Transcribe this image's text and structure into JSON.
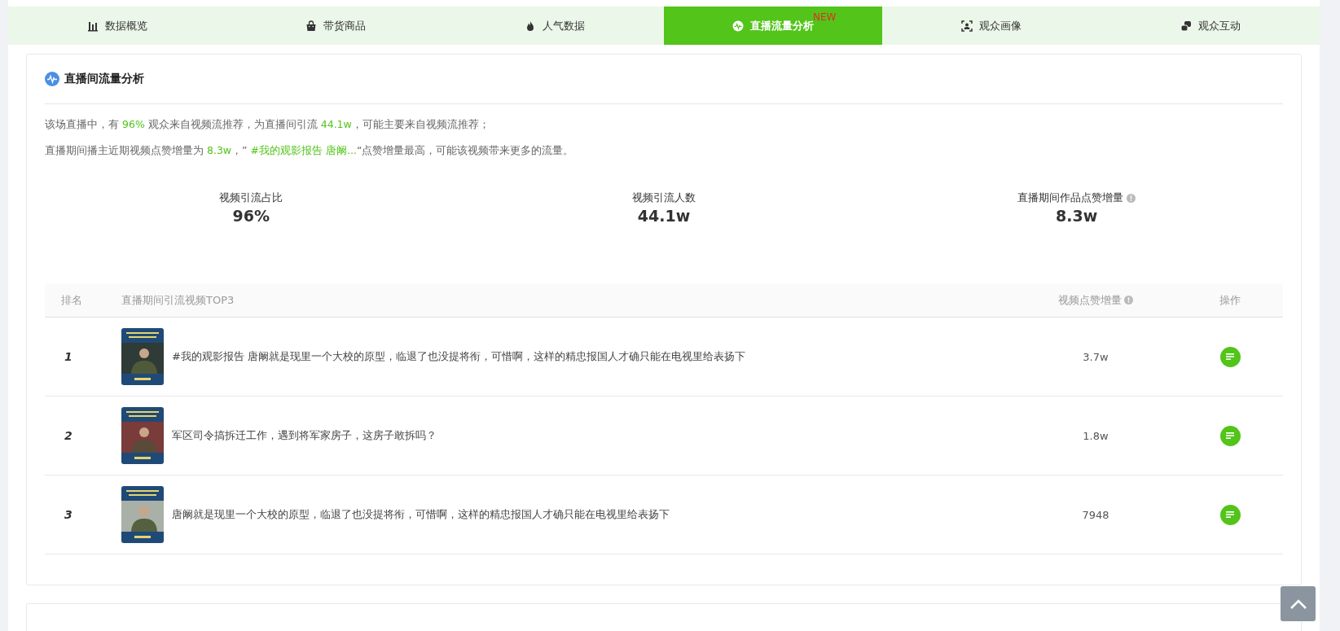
{
  "tabs": [
    {
      "label": "数据概览",
      "selected": false
    },
    {
      "label": "带货商品",
      "selected": false
    },
    {
      "label": "人气数据",
      "selected": false
    },
    {
      "label": "直播流量分析",
      "selected": true,
      "badge": "NEW"
    },
    {
      "label": "观众画像",
      "selected": false
    },
    {
      "label": "观众互动",
      "selected": false
    }
  ],
  "section": {
    "title": "直播间流量分析",
    "summary": [
      [
        {
          "text": "该场直播中，有 ",
          "highlight": false
        },
        {
          "text": "96%",
          "highlight": true
        },
        {
          "text": " 观众来自视频流推荐，为直播间引流 ",
          "highlight": false
        },
        {
          "text": "44.1w",
          "highlight": true
        },
        {
          "text": "，可能主要来自视频流推荐；",
          "highlight": false
        }
      ],
      [
        {
          "text": "直播期间播主近期视频点赞增量为 ",
          "highlight": false
        },
        {
          "text": "8.3w",
          "highlight": true
        },
        {
          "text": "，” ",
          "highlight": false
        },
        {
          "text": "#我的观影报告 唐阚...",
          "highlight": true
        },
        {
          "text": "“点赞增量最高，可能该视频带来更多的流量。",
          "highlight": false
        }
      ]
    ],
    "stats": [
      {
        "label": "视频引流占比",
        "value": "96%",
        "info": false
      },
      {
        "label": "视频引流人数",
        "value": "44.1w",
        "info": false
      },
      {
        "label": "直播期间作品点赞增量",
        "value": "8.3w",
        "info": true
      }
    ],
    "table": {
      "columns": [
        {
          "label": "排名",
          "info": false
        },
        {
          "label": "直播期间引流视频TOP3",
          "info": false
        },
        {
          "label": "视频点赞增量",
          "info": true
        },
        {
          "label": "操作",
          "info": false
        }
      ],
      "rows": [
        {
          "rank": "1",
          "title": "#我的观影报告 唐阚就是现里一个大校的原型，临退了也没提将衔，可惜啊，这样的精忠报国人才确只能在电视里给表扬下",
          "likes": "3.7w"
        },
        {
          "rank": "2",
          "title": "军区司令搞拆迁工作，遇到将军家房子，这房子敢拆吗？",
          "likes": "1.8w"
        },
        {
          "rank": "3",
          "title": "唐阚就是现里一个大校的原型，临退了也没提将衔，可惜啊，这样的精忠报国人才确只能在电视里给表扬下",
          "likes": "7948"
        }
      ]
    }
  }
}
